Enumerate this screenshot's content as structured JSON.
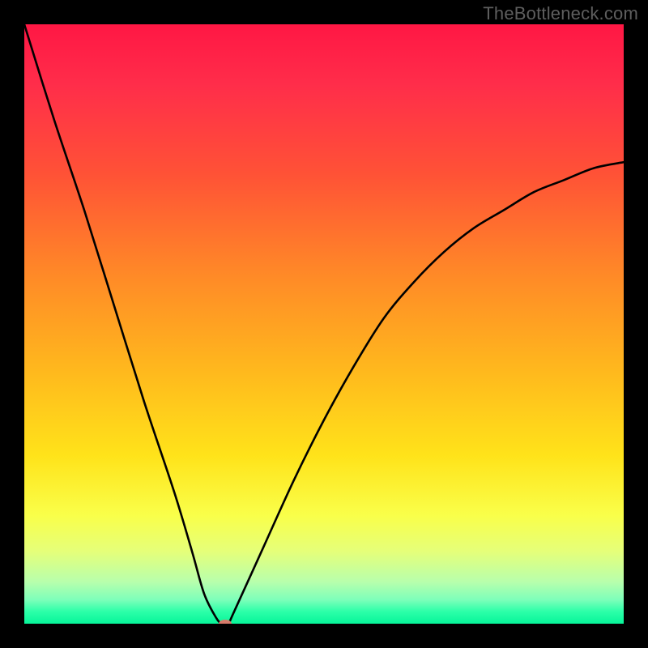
{
  "watermark": "TheBottleneck.com",
  "colors": {
    "frame_bg": "#000000",
    "curve_stroke": "#000000",
    "marker_fill": "#d77a6a",
    "watermark_text": "#5e5e5e"
  },
  "chart_data": {
    "type": "line",
    "title": "",
    "xlabel": "",
    "ylabel": "",
    "xlim": [
      0,
      100
    ],
    "ylim": [
      0,
      100
    ],
    "grid": false,
    "legend": false,
    "series": [
      {
        "name": "bottleneck-curve",
        "x": [
          0,
          5,
          10,
          15,
          20,
          25,
          28,
          30,
          32,
          33,
          34,
          35,
          40,
          45,
          50,
          55,
          60,
          65,
          70,
          75,
          80,
          85,
          90,
          95,
          100
        ],
        "values": [
          100,
          84,
          69,
          53,
          37,
          22,
          12,
          5,
          1,
          0,
          0,
          2,
          13,
          24,
          34,
          43,
          51,
          57,
          62,
          66,
          69,
          72,
          74,
          76,
          77
        ]
      }
    ],
    "annotations": [
      {
        "name": "minimum-marker",
        "x": 33.5,
        "y": 0
      }
    ]
  }
}
